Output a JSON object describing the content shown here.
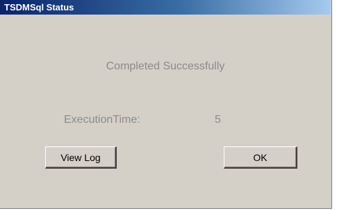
{
  "window": {
    "title": "TSDMSql Status"
  },
  "status": {
    "message": "Completed Successfully"
  },
  "execution": {
    "label": "ExecutionTime:",
    "value": "5"
  },
  "buttons": {
    "view_log": "View Log",
    "ok": "OK"
  },
  "colors": {
    "titlebar_start": "#0a246a",
    "titlebar_end": "#a6caf0",
    "dialog_bg": "#d4d0c8",
    "disabled_text": "#8b8b8b"
  }
}
